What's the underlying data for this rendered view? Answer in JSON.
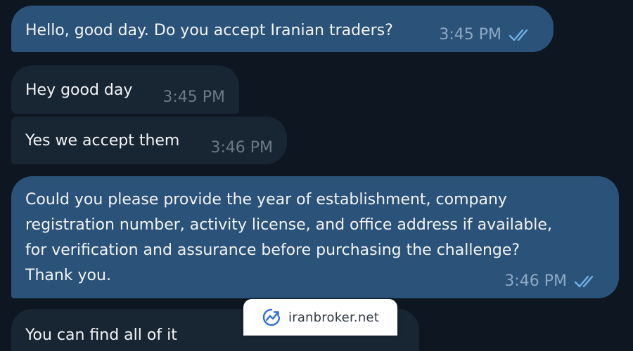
{
  "messages": [
    {
      "text": "Hello, good day. Do you accept Iranian traders?",
      "time": "3:45 PM"
    },
    {
      "text": "Hey good day",
      "time": "3:45 PM"
    },
    {
      "text": "Yes we accept them",
      "time": "3:46 PM"
    },
    {
      "text": "Could you please provide the year of establishment, company\nregistration number, activity license, and office address if available,\nfor verification and assurance before purchasing the challenge?\nThank you.",
      "time": "3:46 PM"
    },
    {
      "text": "You can find all of it"
    }
  ],
  "watermark": {
    "text": "iranbroker.net"
  },
  "colors": {
    "background": "#0e1621",
    "outgoing_bubble": "#2b5278",
    "incoming_bubble": "#182533",
    "read_check": "#6fb1e8"
  }
}
